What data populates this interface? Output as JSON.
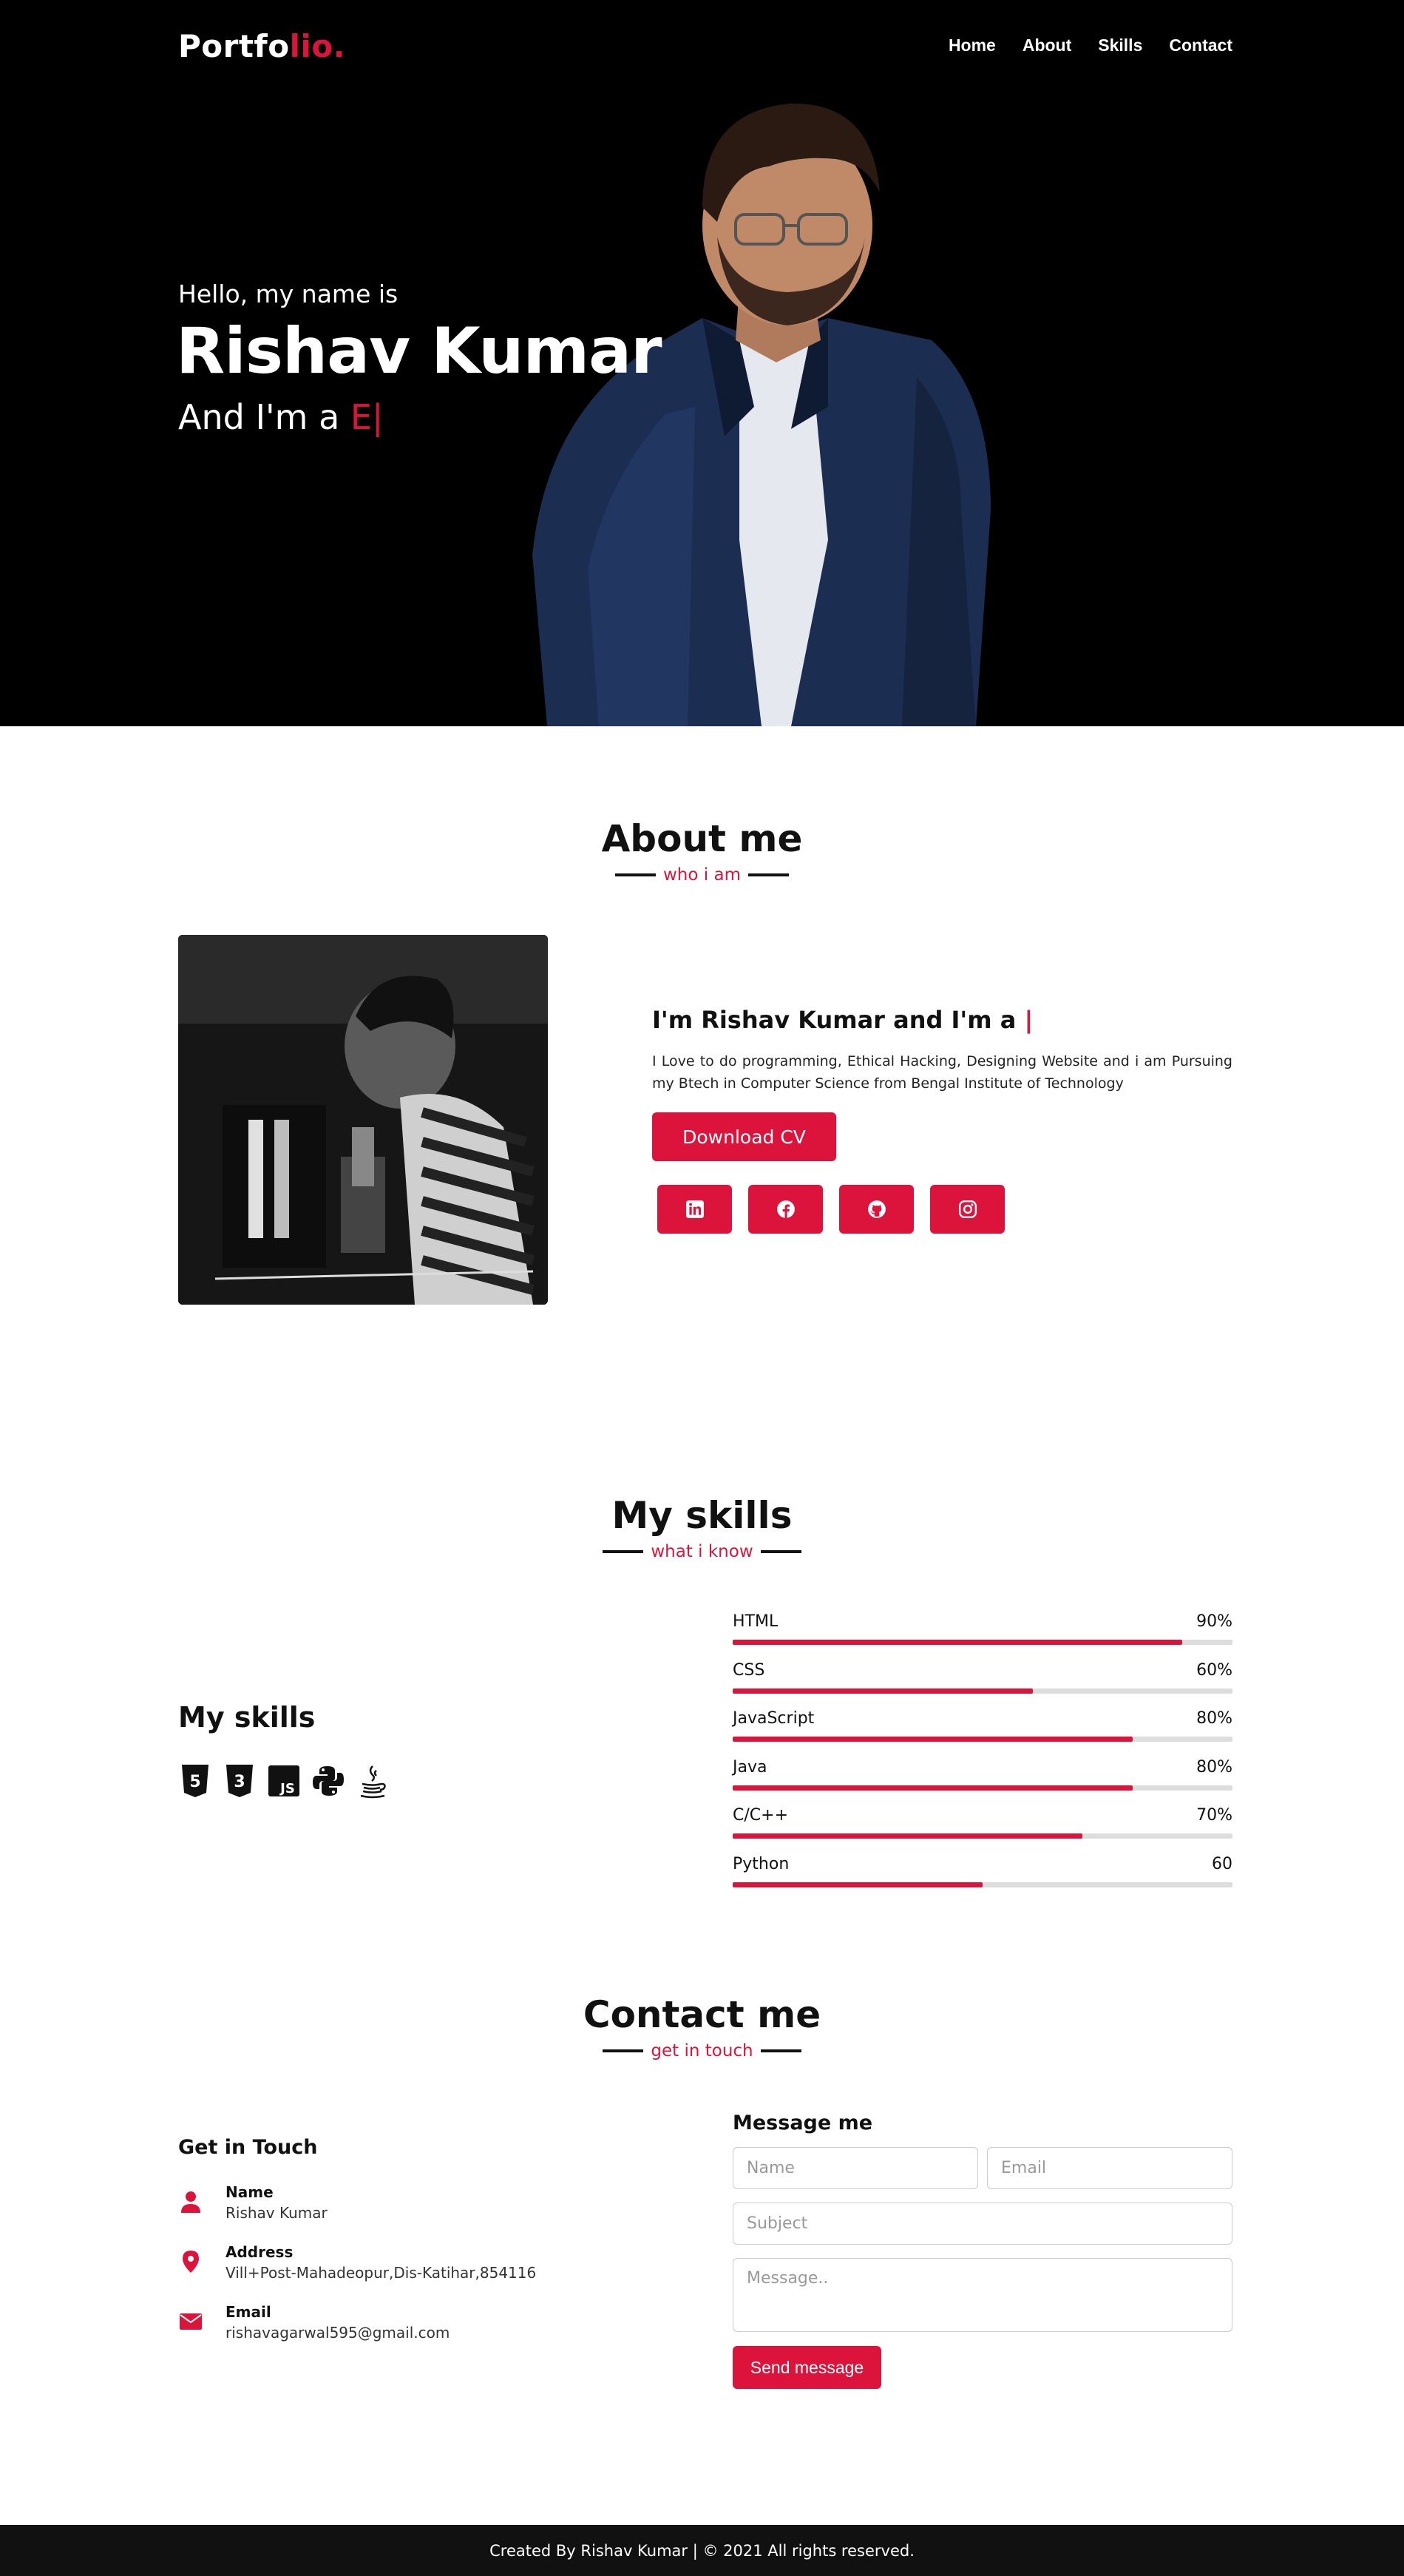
{
  "nav": {
    "logo_main": "Portfo",
    "logo_accent": "lio.",
    "links": [
      "Home",
      "About",
      "Skills",
      "Contact"
    ]
  },
  "hero": {
    "greeting": "Hello, my name is",
    "name": "Rishav Kumar",
    "role_prefix": "And I'm a ",
    "role_typed": "E|"
  },
  "about": {
    "title": "About me",
    "subtitle": "who i am",
    "headline": "I'm Rishav Kumar and I'm a ",
    "cursor": "|",
    "text": "I Love to do programming, Ethical Hacking, Designing Website and i am Pursuing my Btech in Computer Science from Bengal Institute of Technology",
    "download_label": "Download CV",
    "socials": [
      "linkedin-icon",
      "facebook-icon",
      "github-icon",
      "instagram-icon"
    ]
  },
  "skills": {
    "title": "My skills",
    "subtitle": "what i know",
    "left_title": "My skills",
    "icons": [
      "html5-icon",
      "css3-icon",
      "javascript-icon",
      "python-icon",
      "java-icon"
    ],
    "items": [
      {
        "name": "HTML",
        "percent_label": "90%",
        "value": 90
      },
      {
        "name": "CSS",
        "percent_label": "60%",
        "value": 60
      },
      {
        "name": "JavaScript",
        "percent_label": "80%",
        "value": 80
      },
      {
        "name": "Java",
        "percent_label": "80%",
        "value": 80
      },
      {
        "name": "C/C++",
        "percent_label": "70%",
        "value": 70
      },
      {
        "name": "Python",
        "percent_label": "60",
        "value": 50
      }
    ]
  },
  "contact": {
    "title": "Contact me",
    "subtitle": "get in touch",
    "left_title": "Get in Touch",
    "items": [
      {
        "label": "Name",
        "value": "Rishav Kumar"
      },
      {
        "label": "Address",
        "value": "Vill+Post-Mahadeopur,Dis-Katihar,854116"
      },
      {
        "label": "Email",
        "value": "rishavagarwal595@gmail.com"
      }
    ],
    "form_title": "Message me",
    "placeholders": {
      "name": "Name",
      "email": "Email",
      "subject": "Subject",
      "message": "Message.."
    },
    "send_label": "Send message"
  },
  "footer": {
    "text": "Created By Rishav Kumar | © 2021 All rights reserved."
  },
  "colors": {
    "accent": "#dc143c",
    "hero_bg": "#000000",
    "footer_bg": "#111111"
  }
}
